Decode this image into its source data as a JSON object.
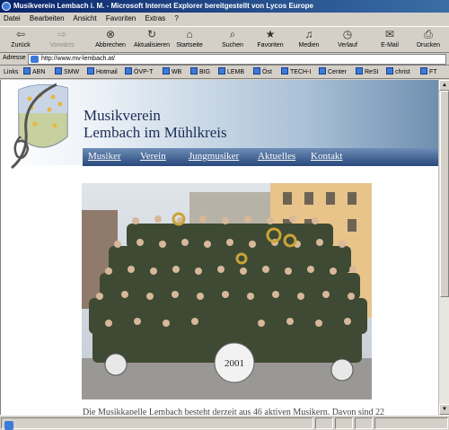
{
  "window": {
    "title": "Musikverein Lembach i. M. - Microsoft Internet Explorer bereitgestellt von Lycos Europe"
  },
  "menu": [
    "Datei",
    "Bearbeiten",
    "Ansicht",
    "Favoriten",
    "Extras",
    "?"
  ],
  "toolbar": {
    "back": "Zurück",
    "forward": "Vorwärts",
    "stop": "Abbrechen",
    "refresh": "Aktualisieren",
    "home": "Startseite",
    "search": "Suchen",
    "favorites": "Favoriten",
    "media": "Medien",
    "history": "Verlauf",
    "mail": "E-Mail",
    "print": "Drucken"
  },
  "address": {
    "label": "Adresse",
    "url": "http://www.mv-lembach.at/"
  },
  "links": {
    "label": "Links",
    "items": [
      "ABN",
      "SMW",
      "Hotmail",
      "ÖVP-T",
      "WB",
      "BIG",
      "LEMB",
      "Öst",
      "TECH-I",
      "Center",
      "ReSI",
      "christ",
      "FT"
    ]
  },
  "site": {
    "title_line1": "Musikverein",
    "title_line2": "Lembach im Mühlkreis",
    "nav": [
      "Musiker",
      "Verein",
      "Jungmusiker",
      "Aktuelles",
      "Kontakt"
    ],
    "drum_label": "2001",
    "body_text": "Die Musikkapelle Lembach besteht derzeit aus 46 aktiven Musikern. Davon sind 22"
  },
  "colors": {
    "banner_text": "#1c2e55",
    "nav_bg": "#27497c",
    "titlebar": "#0a246a"
  }
}
